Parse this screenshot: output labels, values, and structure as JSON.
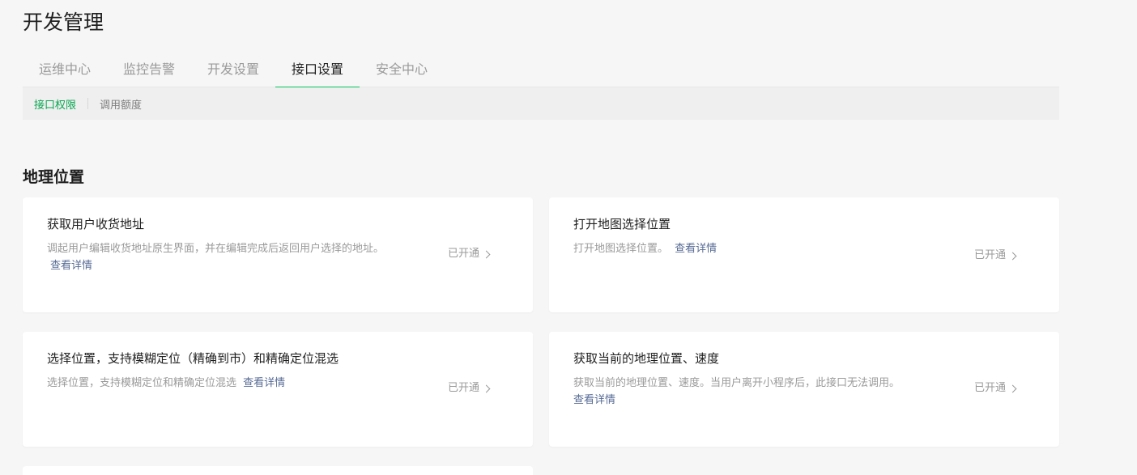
{
  "page": {
    "title": "开发管理"
  },
  "tabs": [
    {
      "label": "运维中心"
    },
    {
      "label": "监控告警"
    },
    {
      "label": "开发设置"
    },
    {
      "label": "接口设置",
      "active": true
    },
    {
      "label": "安全中心"
    }
  ],
  "subnav": [
    {
      "label": "接口权限",
      "active": true
    },
    {
      "label": "调用额度"
    }
  ],
  "section": {
    "title": "地理位置"
  },
  "cards": [
    {
      "title": "获取用户收货地址",
      "desc": "调起用户编辑收货地址原生界面，并在编辑完成后返回用户选择的地址。",
      "link": "查看详情",
      "status": "已开通"
    },
    {
      "title": "打开地图选择位置",
      "desc": "打开地图选择位置。",
      "link": "查看详情",
      "status": "已开通"
    },
    {
      "title": "选择位置，支持模糊定位（精确到市）和精确定位混选",
      "desc": "选择位置，支持模糊定位和精确定位混选",
      "link": "查看详情",
      "status": "已开通"
    },
    {
      "title": "获取当前的地理位置、速度",
      "desc": "获取当前的地理位置、速度。当用户离开小程序后，此接口无法调用。",
      "link": "查看详情",
      "status": "已开通"
    }
  ],
  "colors": {
    "accent": "#07c160",
    "link": "#576b95"
  }
}
